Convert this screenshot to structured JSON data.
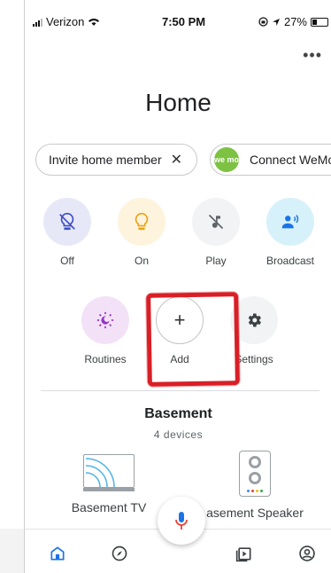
{
  "status_bar": {
    "carrier": "Verizon",
    "time": "7:50 PM",
    "battery": "27%"
  },
  "overflow_menu": "•••",
  "page_title": "Home",
  "chips": {
    "invite": "Invite home member",
    "invite_close": "✕",
    "wemo_logo": "we mo",
    "wemo": "Connect WeMo"
  },
  "actions": [
    {
      "label": "Off",
      "icon": "bulb-off-icon"
    },
    {
      "label": "On",
      "icon": "bulb-on-icon"
    },
    {
      "label": "Play",
      "icon": "music-off-icon"
    },
    {
      "label": "Broadcast",
      "icon": "broadcast-icon"
    },
    {
      "label": "Routines",
      "icon": "routines-icon"
    },
    {
      "label": "Add",
      "icon": "plus-icon",
      "glyph": "+"
    },
    {
      "label": "Settings",
      "icon": "gear-icon"
    }
  ],
  "room": {
    "name": "Basement",
    "count": "4 devices"
  },
  "devices": [
    {
      "name": "Basement TV",
      "icon": "tv-icon"
    },
    {
      "name": "asement Speaker",
      "icon": "speaker-icon"
    }
  ],
  "colors": {
    "accent_blue": "#1a73e8",
    "highlight_red": "#d91f26"
  }
}
